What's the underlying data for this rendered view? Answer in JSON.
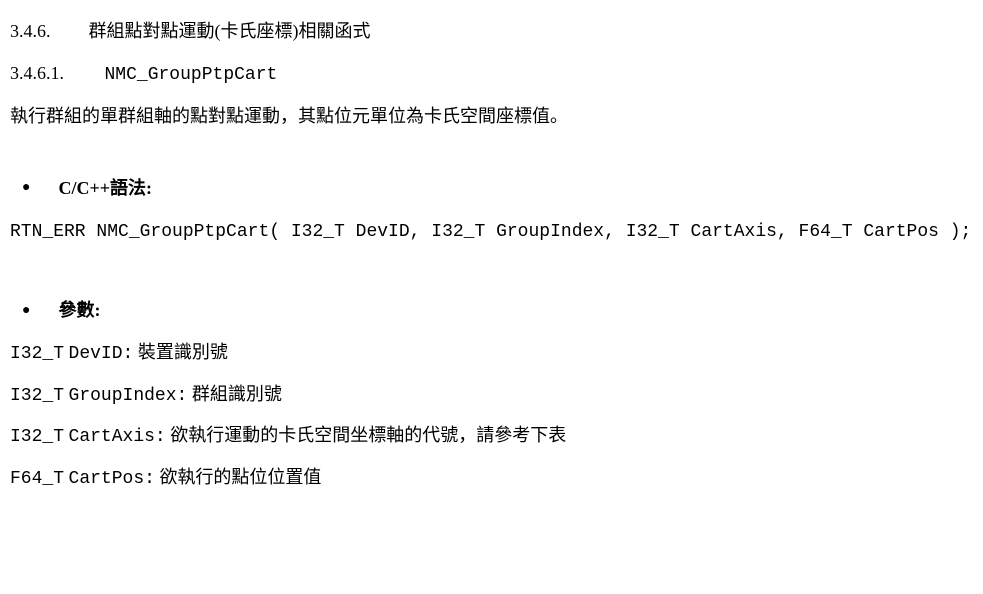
{
  "section": {
    "num": "3.4.6.",
    "title": "群組點對點運動(卡氏座標)相關函式"
  },
  "subsection": {
    "num": "3.4.6.1.",
    "title": "NMC_GroupPtpCart"
  },
  "description": "執行群組的單群組軸的點對點運動，其點位元單位為卡氏空間座標值。",
  "syntax_label": "C/C++語法:",
  "syntax_code": "RTN_ERR NMC_GroupPtpCart( I32_T DevID, I32_T GroupIndex, I32_T CartAxis, F64_T CartPos );",
  "params_label": "參數:",
  "params": [
    {
      "type": "I32_T",
      "name": "DevID:",
      "desc": "裝置識別號"
    },
    {
      "type": "I32_T",
      "name": "GroupIndex:",
      "desc": "群組識別號"
    },
    {
      "type": "I32_T",
      "name": "CartAxis:",
      "desc": "欲執行運動的卡氏空間坐標軸的代號，請參考下表"
    },
    {
      "type": "F64_T",
      "name": "CartPos:",
      "desc": "欲執行的點位位置值"
    }
  ]
}
